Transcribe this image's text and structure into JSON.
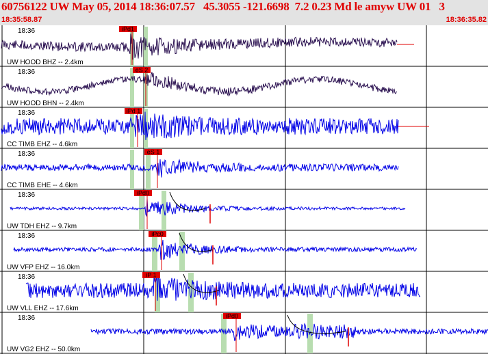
{
  "header": {
    "title": "60756122 UW May 05, 2014 18:36:07.57   45.3055 -121.6698  7.2 0.23 Md le amyw UW 01   3",
    "start_time": "18:35:58.87",
    "end_time": "18:36:35.82"
  },
  "colors": {
    "header_bg": "#e3e3e3",
    "header_text": "#e00000",
    "trace_dark": "#2a1050",
    "trace_blue": "#0000e6",
    "pick": "#e00000",
    "window": "#b8ddb0",
    "grid": "#000000"
  },
  "tick_label": "18:36",
  "traces": [
    {
      "station": "UW HOOD BHZ -- 2.4km",
      "pick": "iPd1",
      "color": "dark"
    },
    {
      "station": "UW HOOD BHN -- 2.4km",
      "pick": "eS 2",
      "color": "dark"
    },
    {
      "station": "CC TIMB EHZ -- 4.6km",
      "pick": "iPd 1",
      "color": "blue"
    },
    {
      "station": "CC TIMB EHE -- 4.6km",
      "pick": "eS 1",
      "color": "blue"
    },
    {
      "station": "UW TDH EHZ -- 9.7km",
      "pick": "iPd0",
      "color": "blue"
    },
    {
      "station": "UW VFP EHZ -- 16.0km",
      "pick": "iPc0",
      "color": "blue"
    },
    {
      "station": "UW VLL EHZ -- 17.6km",
      "pick": "iP 1",
      "color": "blue"
    },
    {
      "station": "UW VG2 EHZ -- 50.0km",
      "pick": "iPd0",
      "color": "blue"
    }
  ]
}
